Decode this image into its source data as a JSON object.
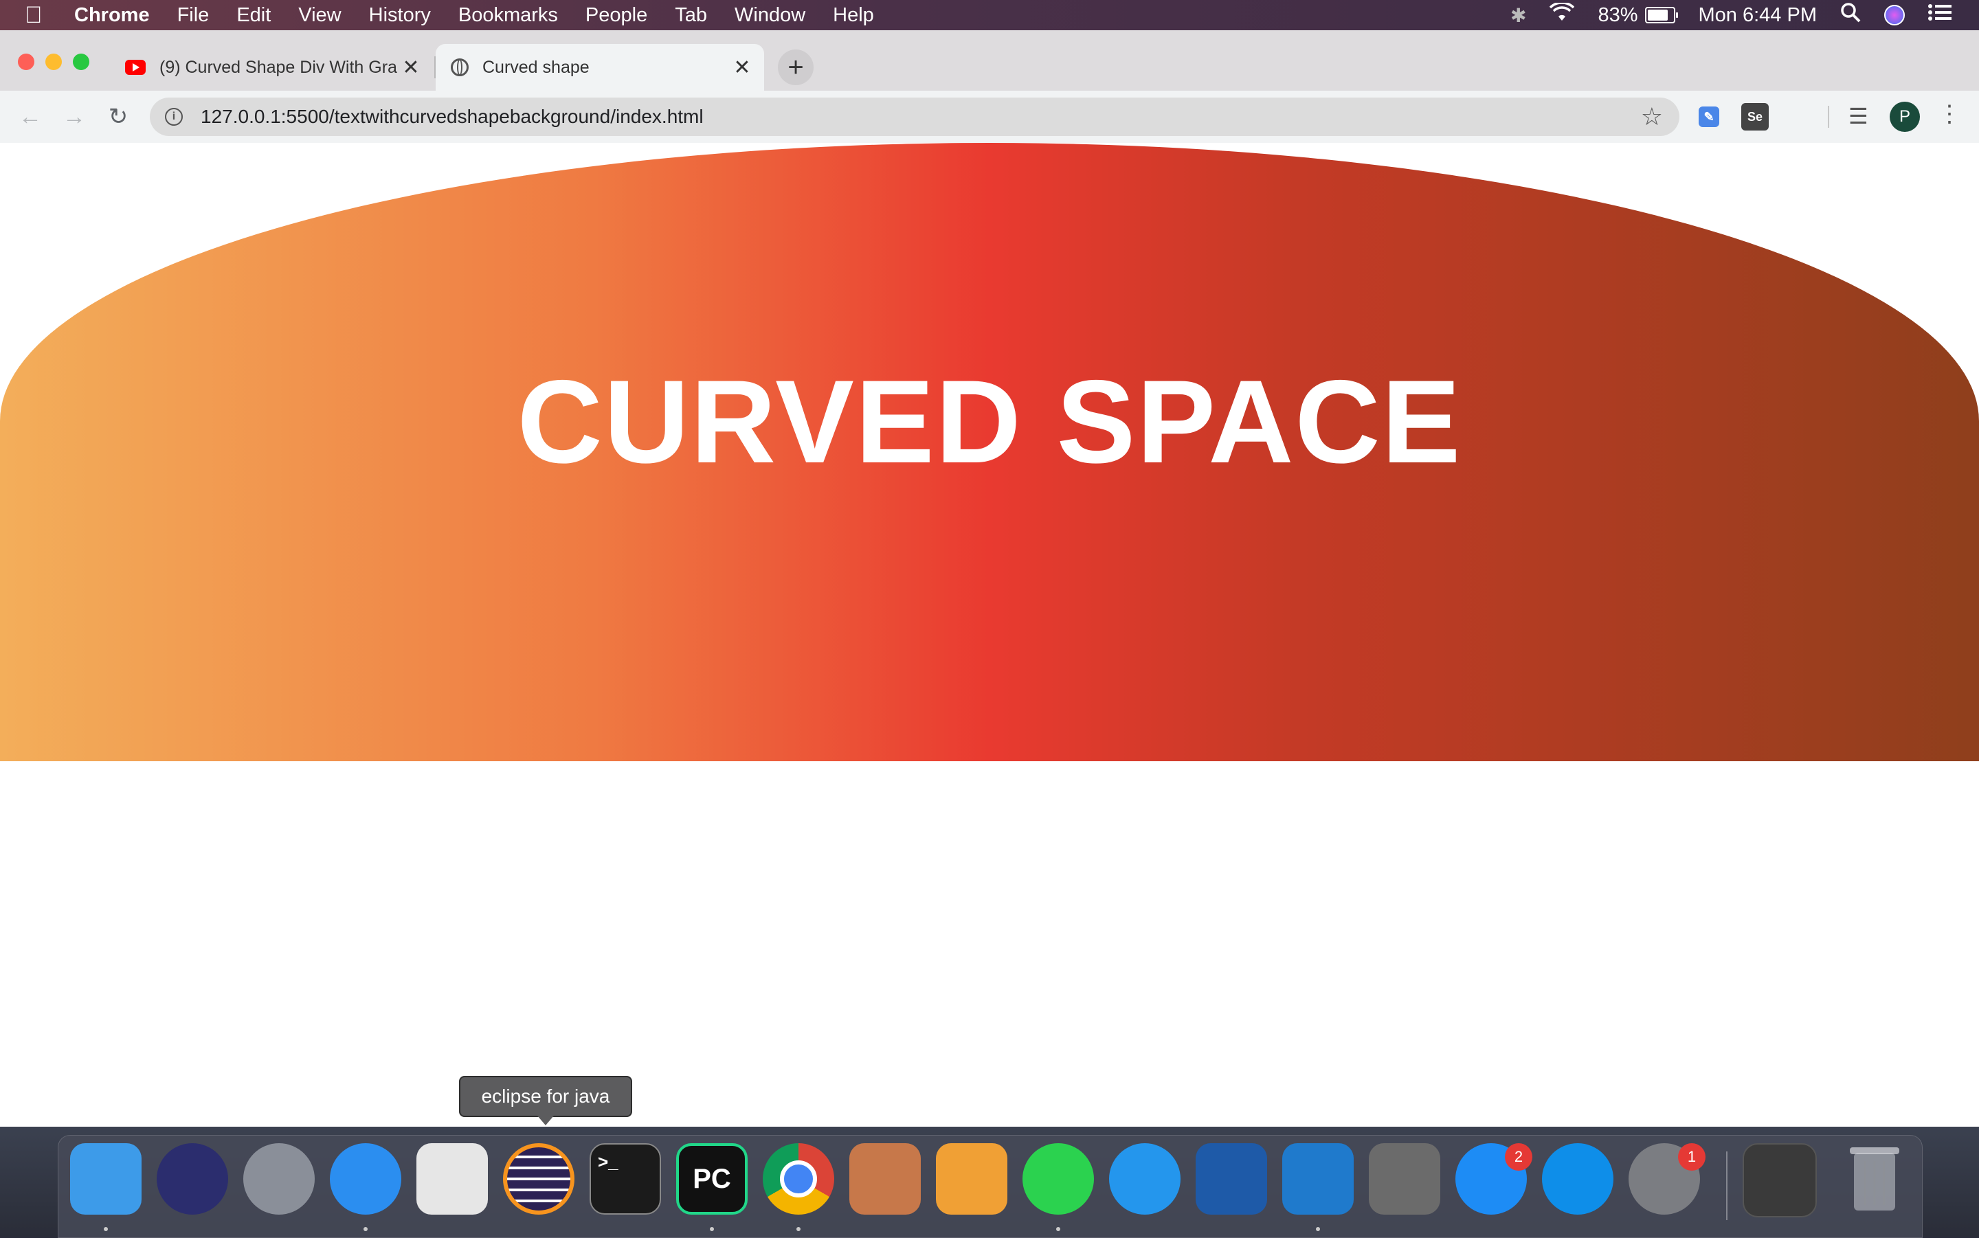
{
  "menubar": {
    "app_name": "Chrome",
    "items": [
      "File",
      "Edit",
      "View",
      "History",
      "Bookmarks",
      "People",
      "Tab",
      "Window",
      "Help"
    ],
    "battery_percent": "83%",
    "battery_level": 0.83,
    "clock": "Mon 6:44 PM"
  },
  "browser": {
    "tabs": [
      {
        "title": "(9) Curved Shape Div With Gra",
        "icon": "youtube-icon",
        "active": false
      },
      {
        "title": "Curved shape",
        "icon": "globe-icon",
        "active": true
      }
    ],
    "new_tab_label": "+",
    "address": "127.0.0.1:5500/textwithcurvedshapebackground/index.html",
    "profile_initial": "P",
    "extensions": [
      "edit-extension-icon",
      "selenium-extension-icon"
    ],
    "extension_2_label": "Se"
  },
  "page": {
    "heading": "CURVED SPACE",
    "gradient_colors": [
      "#f3ae5a",
      "#ef7a42",
      "#e93a30",
      "#c53a26",
      "#8f3f1c"
    ]
  },
  "dock": {
    "tooltip": "eclipse for java",
    "apps": [
      {
        "name": "finder-icon",
        "color": "#3d9be9"
      },
      {
        "name": "siri-icon",
        "color": "#2b2d6e"
      },
      {
        "name": "launchpad-icon",
        "color": "#8a8f99"
      },
      {
        "name": "safari-icon",
        "color": "#2b8ef0"
      },
      {
        "name": "screenshot-icon",
        "color": "#e6e6e6"
      },
      {
        "name": "eclipse-icon",
        "color": "#2c2255"
      },
      {
        "name": "terminal-icon",
        "color": "#1b1b1b"
      },
      {
        "name": "pycharm-icon",
        "color": "#111111"
      },
      {
        "name": "chrome-icon",
        "color": "#e7e7e7"
      },
      {
        "name": "xampp-icon",
        "color": "#c7784a"
      },
      {
        "name": "pages-icon",
        "color": "#f0a035"
      },
      {
        "name": "whatsapp-icon",
        "color": "#2bd24f"
      },
      {
        "name": "docker-icon",
        "color": "#2496ed"
      },
      {
        "name": "virtualbox-icon",
        "color": "#1e5aa8"
      },
      {
        "name": "vscode-icon",
        "color": "#1f7acc"
      },
      {
        "name": "mail-search-icon",
        "color": "#6b6b6b"
      },
      {
        "name": "app-store-icon",
        "color": "#1d8cf5"
      },
      {
        "name": "teamviewer-icon",
        "color": "#0e8ee9"
      },
      {
        "name": "system-preferences-icon",
        "color": "#7b7d82"
      }
    ],
    "badges": {
      "app_store": "2",
      "system_preferences": "1"
    },
    "pycharm_label": "PC",
    "terminal_label": ">_"
  }
}
